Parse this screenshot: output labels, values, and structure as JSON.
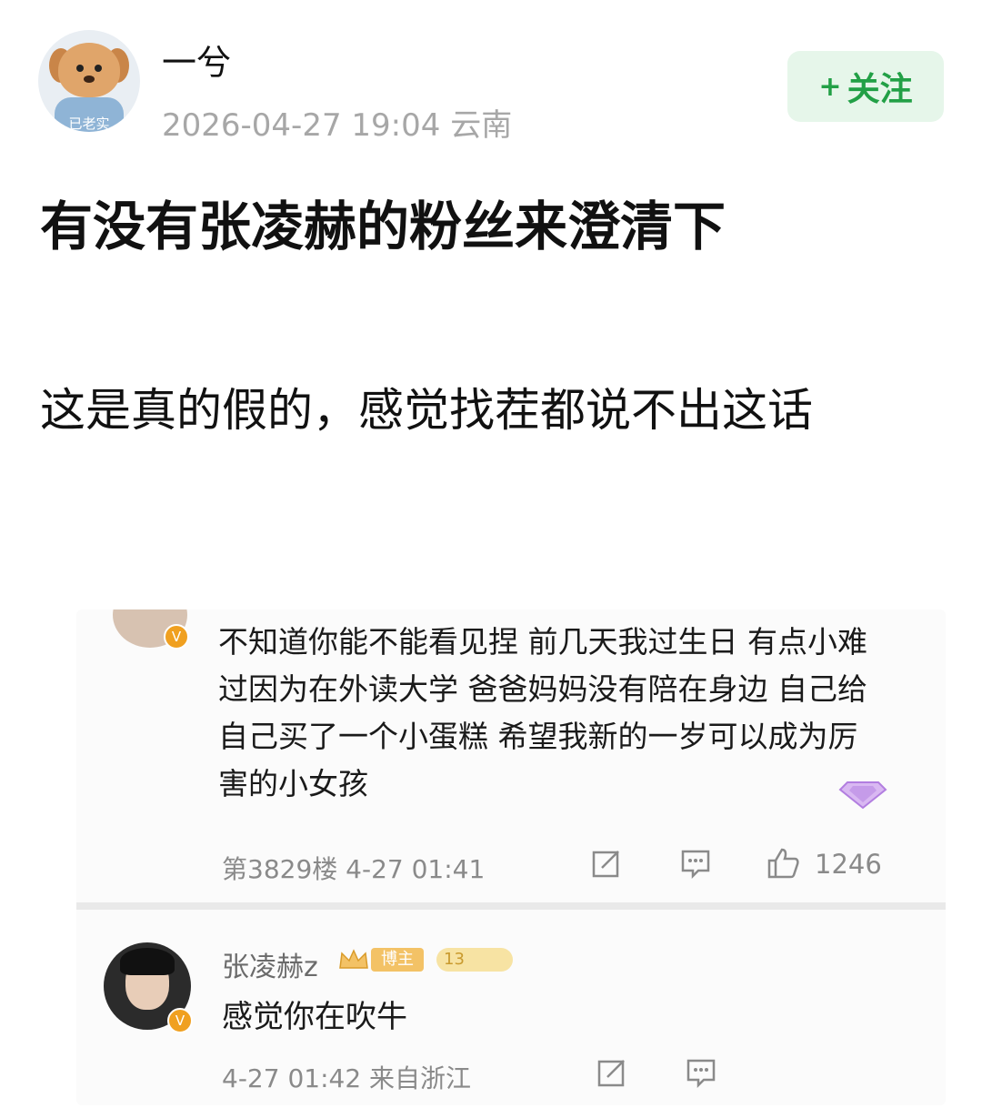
{
  "post": {
    "username": "一兮",
    "avatar_tag": "已老实",
    "timestamp": "2026-04-27 19:04",
    "location": "云南",
    "follow_label": "关注",
    "follow_plus": "+",
    "title": "有没有张凌赫的粉丝来澄清下",
    "body": "这是真的假的，感觉找茬都说不出这话"
  },
  "embedded": {
    "comment1": {
      "text": "不知道你能不能看见捏 前几天我过生日 有点小难过因为在外读大学 爸爸妈妈没有陪在身边 自己给自己买了一个小蛋糕 希望我新的一岁可以成为厉害的小女孩",
      "floor": "第3829楼",
      "time": "4-27 01:41",
      "likes": "1246"
    },
    "comment2": {
      "name": "张凌赫z",
      "host_badge": "博主",
      "level": "13",
      "text": "感觉你在吹牛",
      "time": "4-27 01:42",
      "location": "来自浙江"
    }
  },
  "colors": {
    "follow_green": "#22a046",
    "follow_bg": "#e6f6ea",
    "meta_gray": "#a7a7a7"
  },
  "icons": [
    "share-icon",
    "comment-icon",
    "like-icon",
    "gem-icon",
    "crown-icon",
    "verified-icon"
  ]
}
